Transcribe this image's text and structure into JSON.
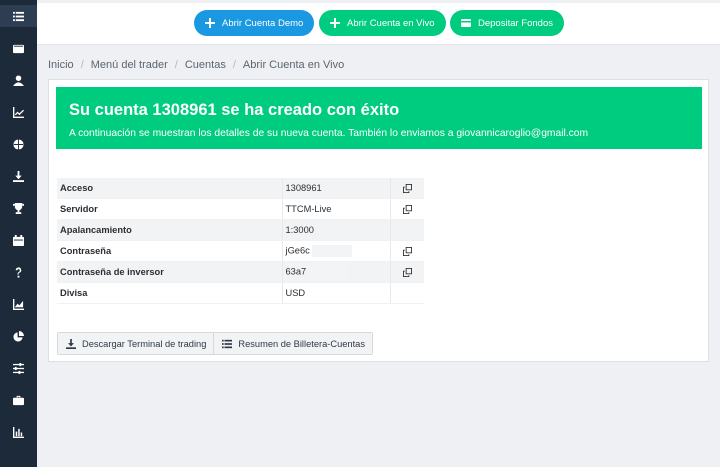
{
  "sidebar": {
    "icons": [
      "list-icon",
      "wallet-icon",
      "user-icon",
      "line-chart-icon",
      "globe-icon",
      "download-icon",
      "trophy-icon",
      "calendar-icon",
      "question-icon",
      "area-chart-icon",
      "pie-chart-icon",
      "sliders-icon",
      "briefcase-icon",
      "bar-chart-icon"
    ]
  },
  "topbar": {
    "demo_label": "Abrir Cuenta Demo",
    "live_label": "Abrir Cuenta en Vivo",
    "deposit_label": "Depositar Fondos"
  },
  "breadcrumb": [
    "Inicio",
    "Menú del trader",
    "Cuentas",
    "Abrir Cuenta en Vivo"
  ],
  "alert": {
    "title": "Su cuenta 1308961 se ha creado con éxito",
    "message": "A continuación se muestran los detalles de su nueva cuenta. También lo enviamos a giovannicaroglio@gmail.com"
  },
  "details": {
    "rows": [
      {
        "label": "Acceso",
        "value": "1308961",
        "copy": true
      },
      {
        "label": "Servidor",
        "value": "TTCM-Live",
        "copy": true
      },
      {
        "label": "Apalancamiento",
        "value": "1:3000",
        "copy": false
      },
      {
        "label": "Contraseña",
        "value": "jGe6c",
        "copy": true
      },
      {
        "label": "Contraseña de inversor",
        "value": "63a7",
        "copy": true
      },
      {
        "label": "Divisa",
        "value": "USD",
        "copy": false
      }
    ]
  },
  "actions": {
    "download_label": "Descargar Terminal de trading",
    "summary_label": "Resumen de Billetera-Cuentas"
  },
  "colors": {
    "accent_green": "#00cc80",
    "accent_blue": "#1a98e2",
    "sidebar": "#1c2a3a"
  }
}
